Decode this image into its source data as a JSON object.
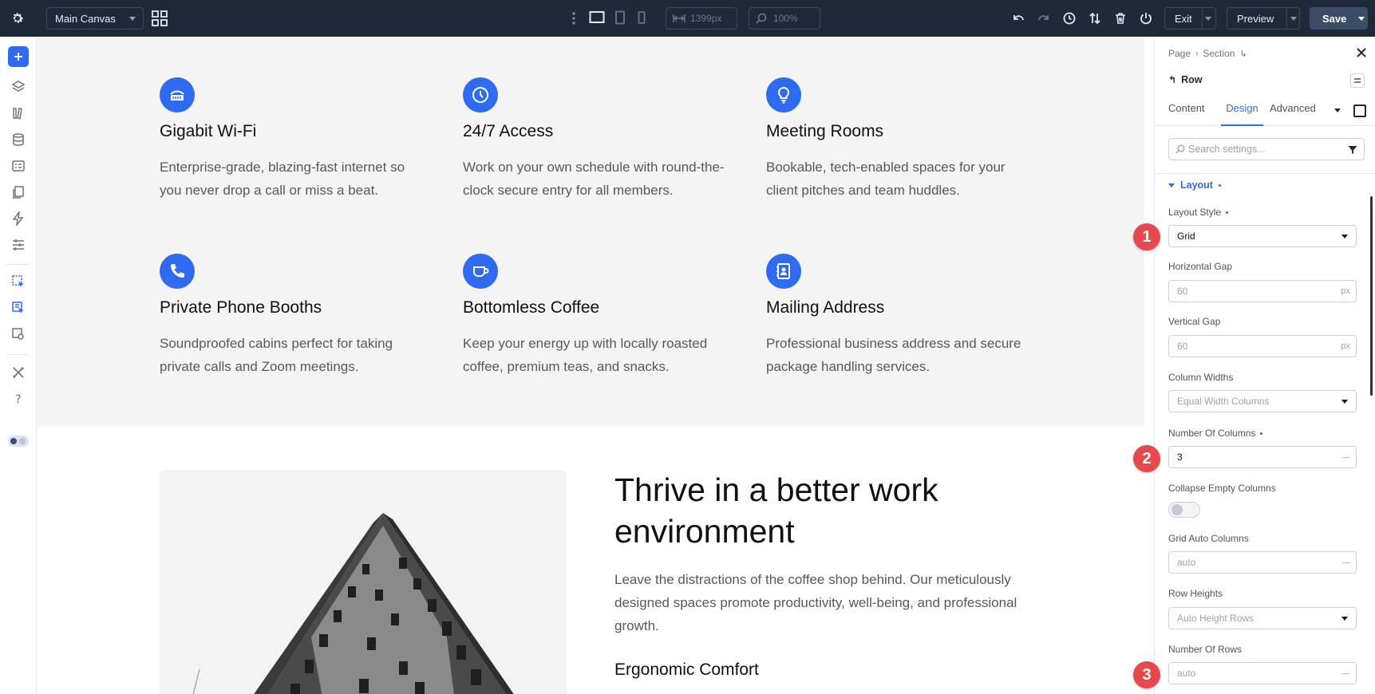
{
  "topbar": {
    "canvas_name": "Main Canvas",
    "width_value": "1399px",
    "zoom_value": "100%",
    "exit_label": "Exit",
    "preview_label": "Preview",
    "save_label": "Save"
  },
  "features": [
    {
      "title": "Gigabit Wi-Fi",
      "desc": "Enterprise-grade, blazing-fast internet so you never drop a call or miss a beat.",
      "icon": "wifi-router-icon"
    },
    {
      "title": "24/7 Access",
      "desc": "Work on your own schedule with round-the-clock secure entry for all members.",
      "icon": "clock-icon"
    },
    {
      "title": "Meeting Rooms",
      "desc": "Bookable, tech-enabled spaces for your client pitches and team huddles.",
      "icon": "lightbulb-icon"
    },
    {
      "title": "Private Phone Booths",
      "desc": "Soundproofed cabins perfect for taking private calls and Zoom meetings.",
      "icon": "phone-icon"
    },
    {
      "title": "Bottomless Coffee",
      "desc": "Keep your energy up with locally roasted coffee, premium teas, and snacks.",
      "icon": "coffee-cup-icon"
    },
    {
      "title": "Mailing Address",
      "desc": "Professional business address and secure package handling services.",
      "icon": "address-book-icon"
    }
  ],
  "hero": {
    "title": "Thrive in a better work environment",
    "desc": "Leave the distractions of the coffee shop behind. Our meticulously designed spaces promote productivity, well-being, and professional growth.",
    "subheading": "Ergonomic Comfort"
  },
  "panel": {
    "crumb_page": "Page",
    "crumb_section": "Section",
    "element": "Row",
    "tabs": [
      "Content",
      "Design",
      "Advanced"
    ],
    "active_tab": "Design",
    "search_placeholder": "Search settings...",
    "group": "Layout",
    "layout_style_label": "Layout Style",
    "layout_style_value": "Grid",
    "h_gap_label": "Horizontal Gap",
    "h_gap_value": "60",
    "v_gap_label": "Vertical Gap",
    "v_gap_value": "60",
    "gap_unit": "px",
    "col_widths_label": "Column Widths",
    "col_widths_value": "Equal Width Columns",
    "num_cols_label": "Number Of Columns",
    "num_cols_value": "3",
    "collapse_label": "Collapse Empty Columns",
    "collapse_on": false,
    "grid_auto_label": "Grid Auto Columns",
    "grid_auto_value": "auto",
    "row_heights_label": "Row Heights",
    "row_heights_value": "Auto Height Rows",
    "num_rows_label": "Number Of Rows",
    "num_rows_value": "auto"
  },
  "badges": [
    "1",
    "2",
    "3"
  ],
  "colors": {
    "accent": "#2f6bf0",
    "badge": "#e5484d",
    "topbar": "#1e2a3a"
  }
}
